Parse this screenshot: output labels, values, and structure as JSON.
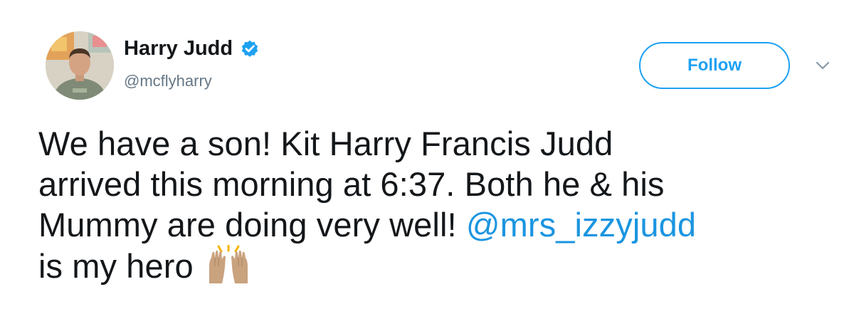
{
  "user": {
    "display_name": "Harry Judd",
    "handle": "@mcflyharry",
    "verified": true,
    "avatar_icon": "profile-photo"
  },
  "actions": {
    "follow_label": "Follow",
    "menu_icon": "chevron-down-icon"
  },
  "tweet": {
    "line1": "We have a son! Kit Harry Francis Judd",
    "line2": "arrived this morning at 6:37. Both he & his",
    "line3_text": "Mummy are doing very well! ",
    "mention": "@mrs_izzyjudd",
    "line4_text": "is my hero",
    "emoji_icon": "raising-hands-emoji"
  },
  "colors": {
    "accent": "#1da1f2",
    "link": "#1b95e0",
    "text": "#14171a",
    "secondary_text": "#657786"
  }
}
